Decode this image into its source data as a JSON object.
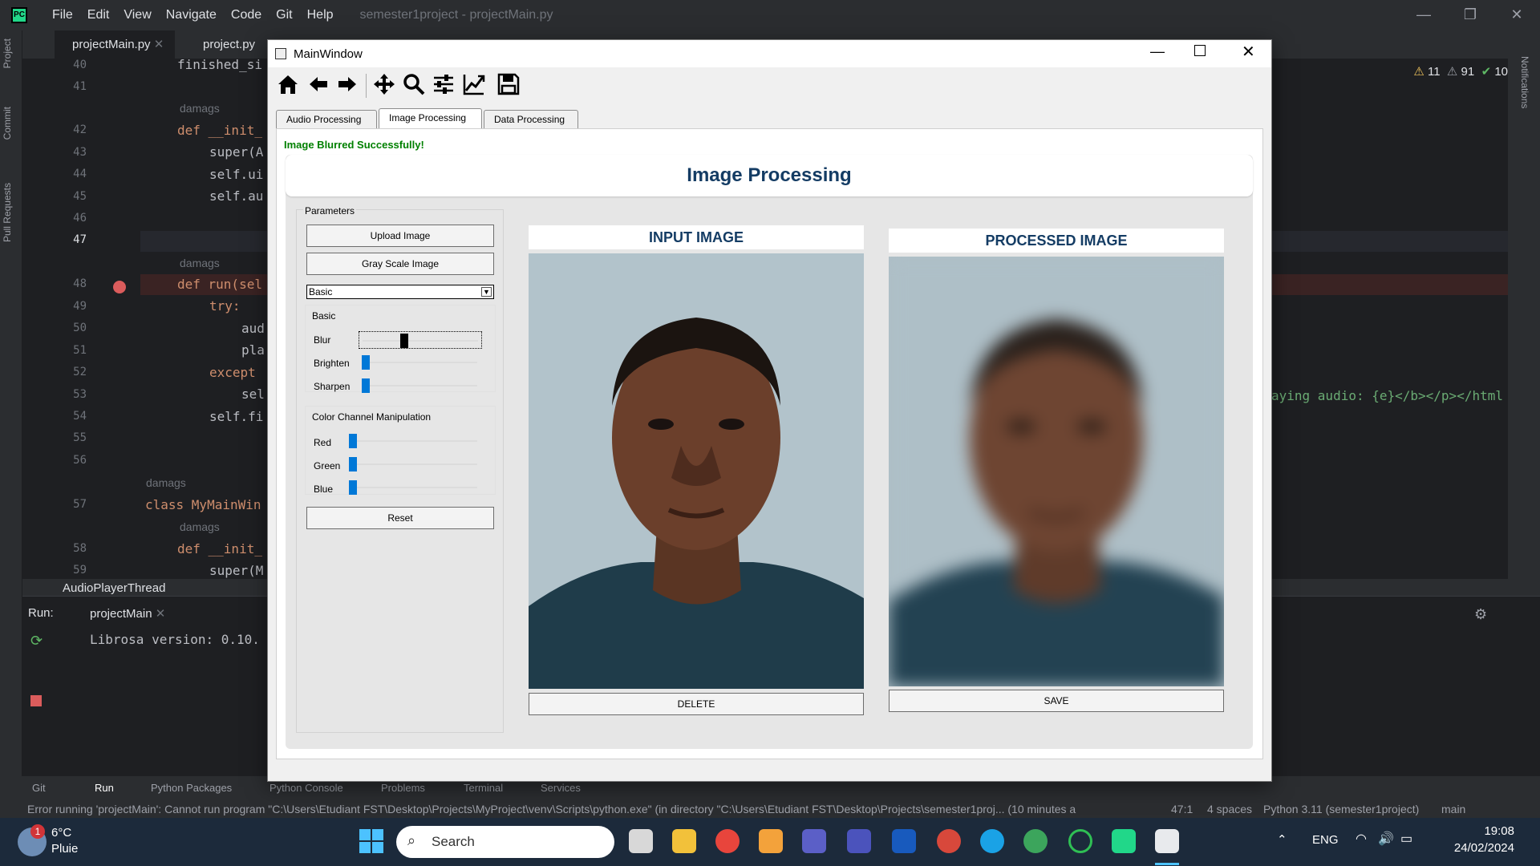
{
  "ide": {
    "menu": [
      "File",
      "Edit",
      "View",
      "Navigate",
      "Code",
      "Git",
      "Help"
    ],
    "project_title": "semester1project - projectMain.py",
    "tabs": [
      "projectMain.py",
      "project.py"
    ],
    "side_tabs": [
      "Project",
      "Commit",
      "Pull Requests"
    ],
    "right_side_tab": "Notifications",
    "inspections": {
      "warnings": "11",
      "weak": "91",
      "ok": "10"
    },
    "line_numbers": [
      "40",
      "41",
      "42",
      "43",
      "44",
      "45",
      "46",
      "47",
      "48",
      "49",
      "50",
      "51",
      "52",
      "53",
      "54",
      "55",
      "56",
      "57",
      "58",
      "59"
    ],
    "code_lines": {
      "l40": "finished_si",
      "l42": "def __init_",
      "l43": "super(A",
      "l44": "self.ui",
      "l45": "self.au",
      "l48": "def run(sel",
      "l49": "try:",
      "l50": "aud",
      "l51": "pla",
      "l52": "except ",
      "l53": "sel",
      "l54": "self.fi",
      "l57": "class MyMainWin",
      "l58": "def __init_",
      "l59": "super(M"
    },
    "author_hints": [
      "damags",
      "damags",
      "damags",
      "damags"
    ],
    "right_code": "aying audio: {e}</b></p></html",
    "breadcrumb": "AudioPlayerThread",
    "run_label": "Run:",
    "run_tab": "projectMain",
    "console_output": "Librosa version: 0.10.",
    "tool_tabs": [
      "Git",
      "Run",
      "Python Packages",
      "Python Console",
      "Problems",
      "Terminal",
      "Services"
    ],
    "status_message": "Error running 'projectMain': Cannot run program \"C:\\Users\\Etudiant FST\\Desktop\\Projects\\MyProject\\venv\\Scripts\\python.exe\" (in directory \"C:\\Users\\Etudiant FST\\Desktop\\Projects\\semester1proj... (10 minutes a",
    "cursor_pos": "47:1",
    "indent": "4 spaces",
    "interpreter": "Python 3.11 (semester1project)",
    "branch": "main"
  },
  "taskbar": {
    "weather_temp": "6°C",
    "weather_desc": "Pluie",
    "weather_badge": "1",
    "search_placeholder": "Search",
    "lang": "ENG",
    "time": "19:08",
    "date": "24/02/2024"
  },
  "app": {
    "window_title": "MainWindow",
    "tabs": [
      "Audio Processing",
      "Image Processing",
      "Data Processing"
    ],
    "active_tab": "Image Processing",
    "status": "Image Blurred Successfully!",
    "heading": "Image Processing",
    "params": {
      "title": "Parameters",
      "upload": "Upload Image",
      "grayscale": "Gray Scale Image",
      "mode_value": "Basic",
      "basic_group": "Basic",
      "blur": "Blur",
      "brighten": "Brighten",
      "sharpen": "Sharpen",
      "blur_level": 0.35,
      "brighten_level": 0,
      "sharpen_level": 0,
      "color_group": "Color Channel Manipulation",
      "red": "Red",
      "green": "Green",
      "blue": "Blue",
      "red_level": 0,
      "green_level": 0,
      "blue_level": 0,
      "reset": "Reset"
    },
    "input_title": "INPUT IMAGE",
    "processed_title": "PROCESSED IMAGE",
    "delete": "DELETE",
    "save": "SAVE"
  }
}
